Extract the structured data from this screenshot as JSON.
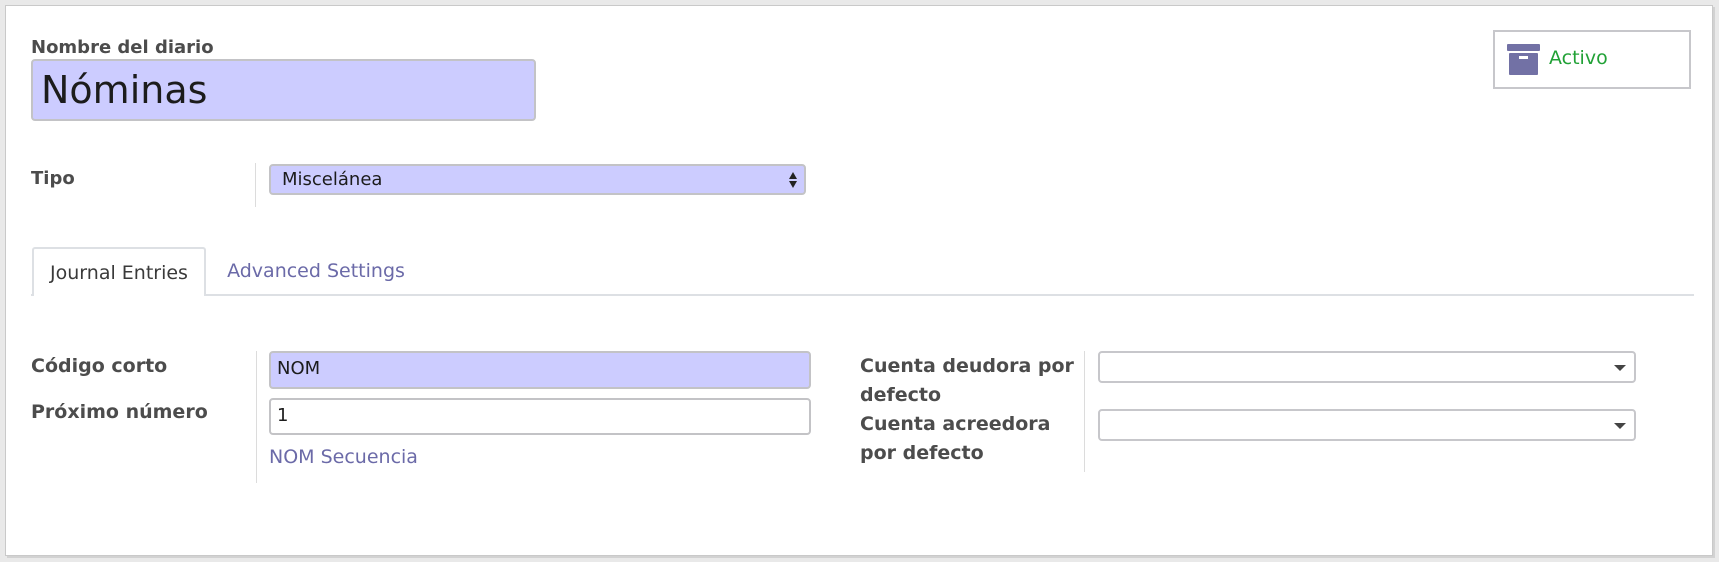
{
  "form": {
    "name_label": "Nombre del diario",
    "name_value": "Nóminas",
    "active_button": {
      "label": "Activo",
      "icon": "archive-icon",
      "icon_color": "#7271a5",
      "text_color": "#21a136"
    },
    "type": {
      "label": "Tipo",
      "selected": "Miscelánea"
    }
  },
  "tabs": [
    {
      "label": "Journal Entries",
      "active": true
    },
    {
      "label": "Advanced Settings",
      "active": false
    }
  ],
  "journal_entries": {
    "short_code": {
      "label": "Código corto",
      "value": "NOM"
    },
    "next_number": {
      "label": "Próximo número",
      "value": "1"
    },
    "sequence_link": "NOM Secuencia",
    "default_debit_account": {
      "label": "Cuenta deudora por defecto",
      "value": ""
    },
    "default_credit_account": {
      "label": "Cuenta acreedora por defecto",
      "value": ""
    }
  },
  "colors": {
    "required_field_bg": "#ccccff",
    "link": "#6b6aa8"
  }
}
